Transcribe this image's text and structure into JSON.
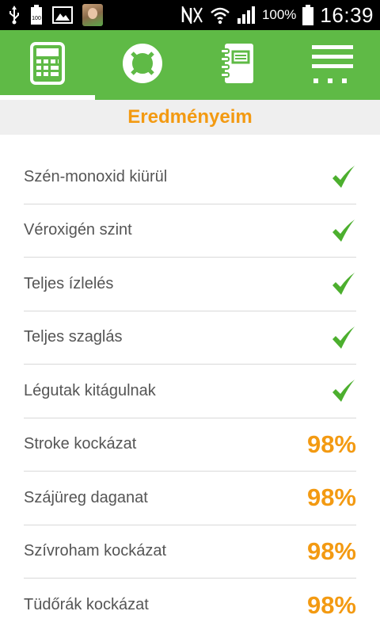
{
  "status_bar": {
    "battery_percent": "100%",
    "time": "16:39",
    "icons": [
      "usb-icon",
      "battery-100-icon",
      "image-icon",
      "avatar",
      "nfc-icon",
      "wifi-icon",
      "signal-icon",
      "battery-icon"
    ]
  },
  "tabs": [
    {
      "name": "calculator-icon",
      "active": true
    },
    {
      "name": "lifebuoy-icon",
      "active": false
    },
    {
      "name": "notebook-icon",
      "active": false
    },
    {
      "name": "menu-icon",
      "active": false
    }
  ],
  "section_title": "Eredményeim",
  "results": [
    {
      "label": "Szén-monoxid kiürül",
      "value": "",
      "check": true
    },
    {
      "label": "Véroxigén szint",
      "value": "",
      "check": true
    },
    {
      "label": "Teljes ízlelés",
      "value": "",
      "check": true
    },
    {
      "label": "Teljes szaglás",
      "value": "",
      "check": true
    },
    {
      "label": "Légutak kitágulnak",
      "value": "",
      "check": true
    },
    {
      "label": "Stroke kockázat",
      "value": "98%",
      "check": false
    },
    {
      "label": "Szájüreg daganat",
      "value": "98%",
      "check": false
    },
    {
      "label": "Szívroham kockázat",
      "value": "98%",
      "check": false
    },
    {
      "label": "Tüdőrák kockázat",
      "value": "98%",
      "check": false
    }
  ],
  "colors": {
    "tab_bar": "#5fba46",
    "accent": "#f39a12",
    "check": "#4caf2e"
  }
}
